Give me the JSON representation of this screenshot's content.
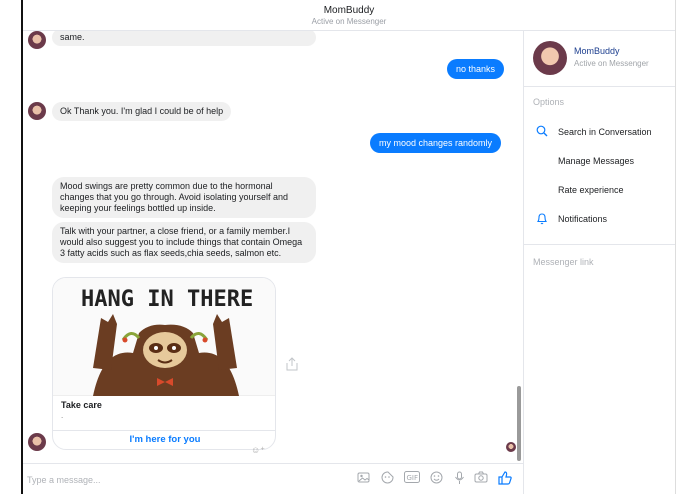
{
  "header": {
    "title": "MomBuddy",
    "subtitle": "Active on Messenger"
  },
  "messages": {
    "partial_incoming": "same.",
    "outgoing_1": "no thanks",
    "incoming_1": "Ok Thank you. I'm glad I could be of help",
    "outgoing_2": "my mood changes randomly",
    "incoming_2": "Mood swings are pretty common due to the hormonal changes that you go through. Avoid isolating yourself and keeping your feelings bottled up inside.",
    "incoming_3": "Talk with your partner, a close friend, or a family member.I would also suggest you to include things that contain Omega 3 fatty acids such as flax seeds,chia seeds, salmon etc.",
    "card": {
      "image_text": "HANG IN THERE",
      "title": "Take care",
      "subtitle": ".",
      "button": "I'm here for you"
    }
  },
  "composer": {
    "placeholder": "Type a message...",
    "tools": [
      "image-icon",
      "sticker-icon",
      "gif-icon",
      "emoji-icon",
      "mic-icon",
      "camera-icon",
      "like-icon"
    ]
  },
  "sidebar": {
    "name": "MomBuddy",
    "status": "Active on Messenger",
    "options_label": "Options",
    "items": [
      {
        "label": "Search in Conversation",
        "icon": "search-icon"
      },
      {
        "label": "Manage Messages",
        "icon": ""
      },
      {
        "label": "Rate experience",
        "icon": ""
      },
      {
        "label": "Notifications",
        "icon": "bell-icon"
      }
    ],
    "messenger_link": "Messenger link"
  },
  "colors": {
    "accent": "#0a7cff",
    "incoming_bubble": "#f0f0f0"
  }
}
